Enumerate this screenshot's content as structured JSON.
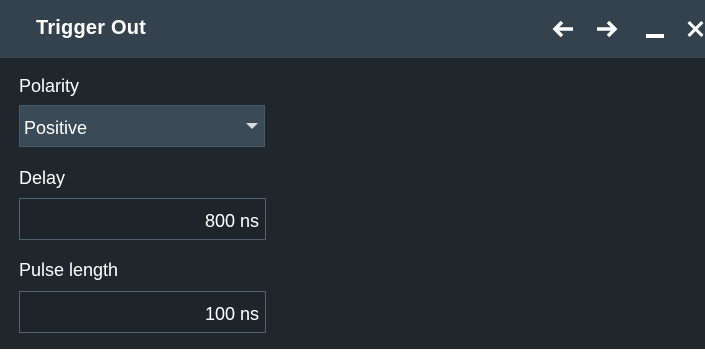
{
  "window": {
    "title": "Trigger Out"
  },
  "titlebar_buttons": [
    {
      "name": "back-arrow-icon"
    },
    {
      "name": "forward-arrow-icon"
    },
    {
      "name": "minimize-icon"
    },
    {
      "name": "close-icon"
    }
  ],
  "polarity": {
    "label": "Polarity",
    "value": "Positive"
  },
  "delay": {
    "label": "Delay",
    "value": "800 ns"
  },
  "pulse_length": {
    "label": "Pulse length",
    "value": "100 ns"
  },
  "colors": {
    "panel_bg": "#1f272d",
    "titlebar_bg": "#33424c",
    "text": "#ffffff"
  }
}
